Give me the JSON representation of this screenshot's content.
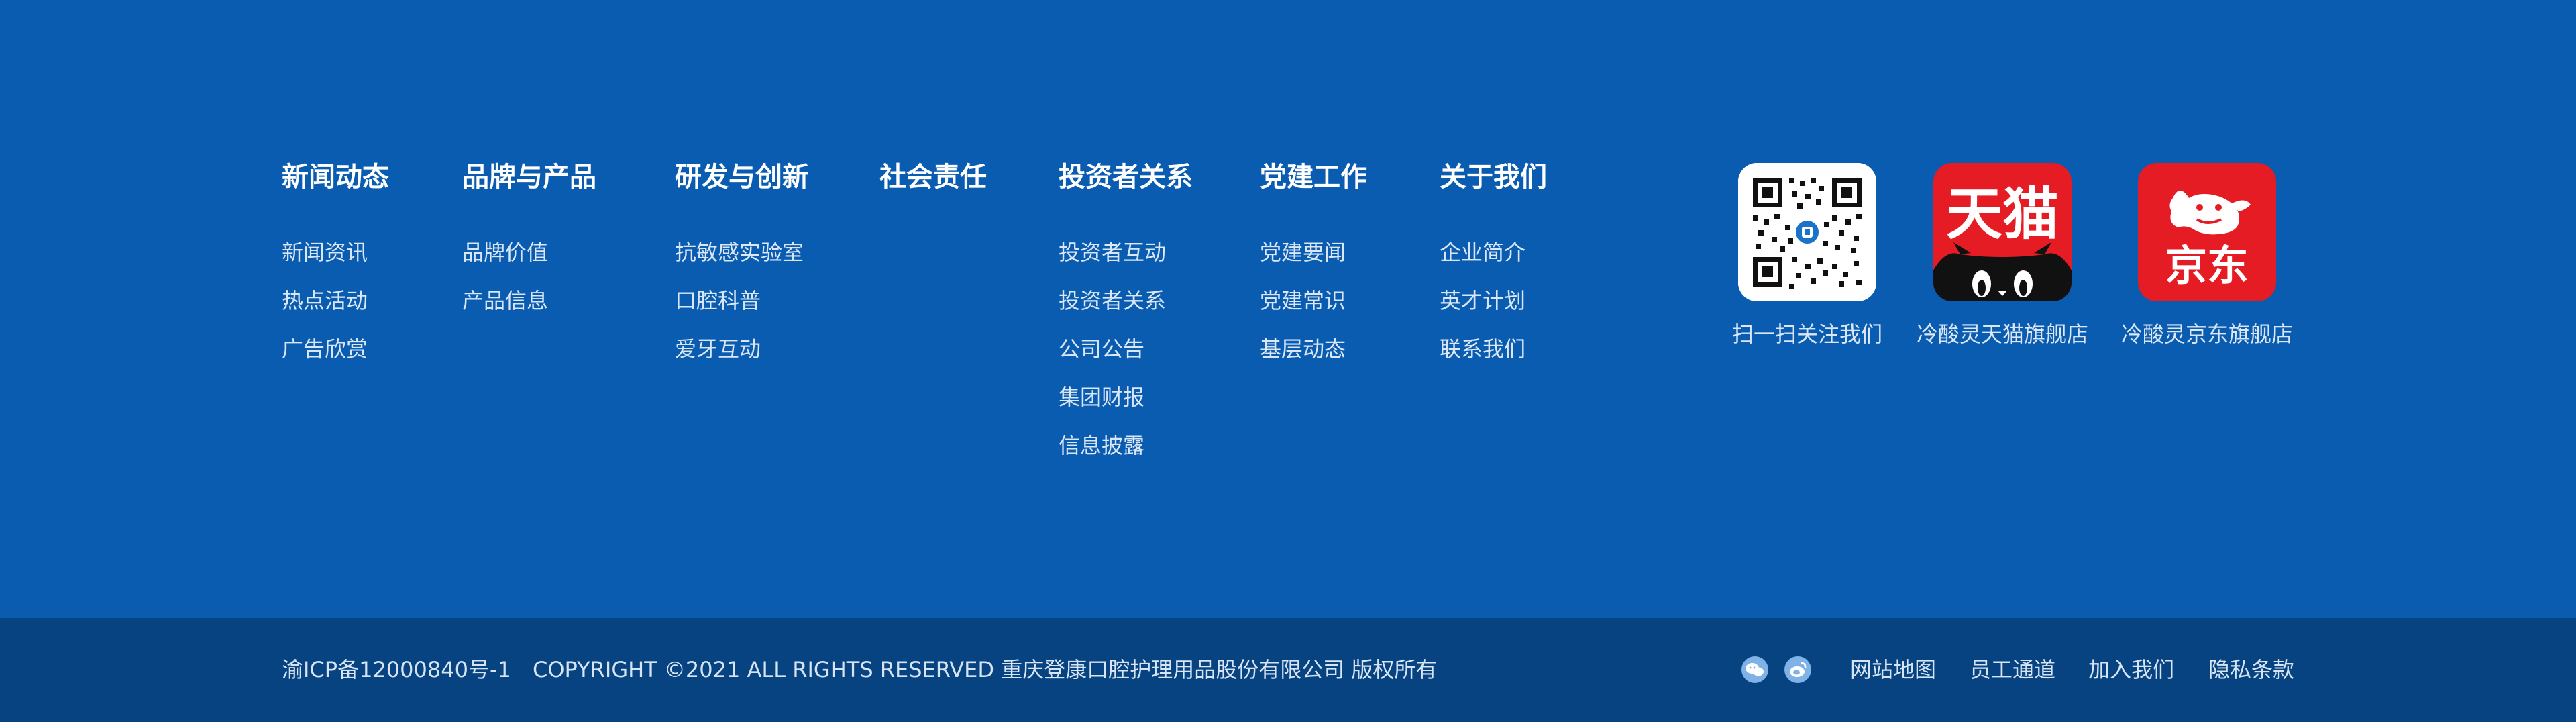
{
  "nav": [
    {
      "title": "新闻动态",
      "links": [
        "新闻资讯",
        "热点活动",
        "广告欣赏"
      ]
    },
    {
      "title": "品牌与产品",
      "links": [
        "品牌价值",
        "产品信息"
      ]
    },
    {
      "title": "研发与创新",
      "links": [
        "抗敏感实验室",
        "口腔科普",
        "爱牙互动"
      ]
    },
    {
      "title": "社会责任",
      "links": []
    },
    {
      "title": "投资者关系",
      "links": [
        "投资者互动",
        "投资者关系",
        "公司公告",
        "集团财报",
        "信息披露"
      ]
    },
    {
      "title": "党建工作",
      "links": [
        "党建要闻",
        "党建常识",
        "基层动态"
      ]
    },
    {
      "title": "关于我们",
      "links": [
        "企业简介",
        "英才计划",
        "联系我们"
      ]
    }
  ],
  "stores": [
    {
      "label": "扫一扫关注我们",
      "icon": "qr-code-icon"
    },
    {
      "label": "冷酸灵天猫旗舰店",
      "icon": "tmall-logo-icon",
      "logo_text": "天猫"
    },
    {
      "label": "冷酸灵京东旗舰店",
      "icon": "jd-logo-icon",
      "logo_text": "京东"
    }
  ],
  "footer": {
    "icp": "渝ICP备12000840号-1",
    "copyright": "COPYRIGHT ©2021 ALL RIGHTS RESERVED 重庆登康口腔护理用品股份有限公司 版权所有",
    "links": [
      "网站地图",
      "员工通道",
      "加入我们",
      "隐私条款"
    ],
    "social_icons": [
      "wechat-icon",
      "weibo-icon"
    ]
  },
  "colors": {
    "top_bg": "#0a5cb0",
    "bottom_bg": "#074381",
    "logo_red": "#e51c23"
  }
}
